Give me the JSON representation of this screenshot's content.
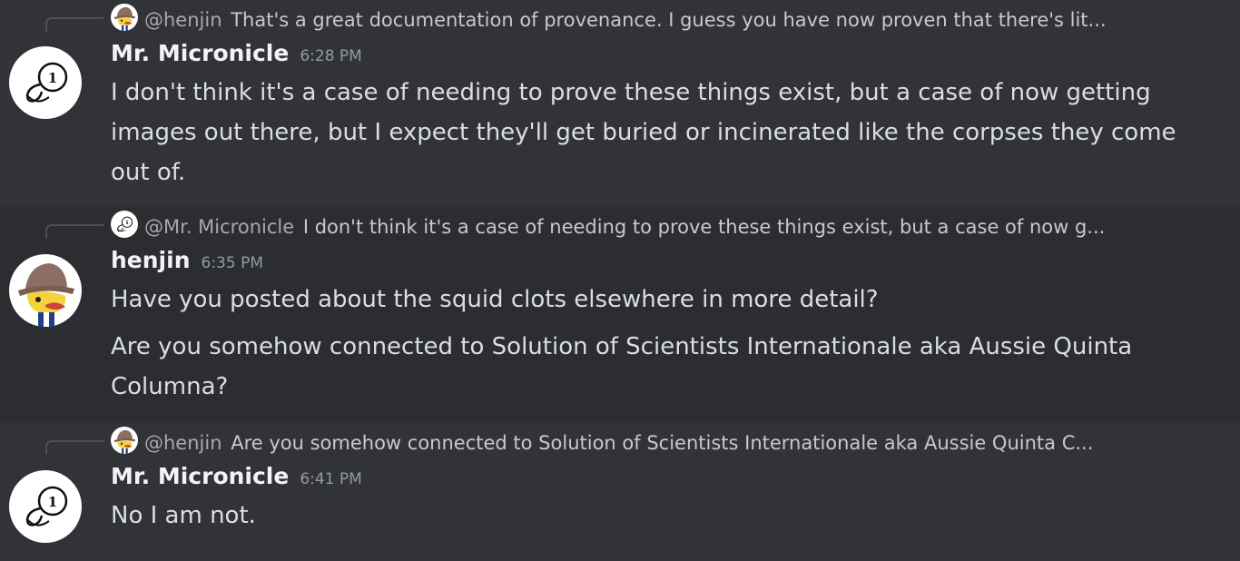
{
  "messages": [
    {
      "reply": {
        "author": "@henjin",
        "text": "That's a great documentation of provenance. I guess you have now proven that there's lit..."
      },
      "author": "Mr. Micronicle",
      "time": "6:28 PM",
      "lines": [
        "I don't think it's a case of needing to prove these things exist, but a case of now getting images out there, but I expect they'll get buried or incinerated  like the corpses they come out of."
      ]
    },
    {
      "reply": {
        "author": "@Mr. Micronicle",
        "text": "I don't think it's a case of needing to prove these things exist, but a case of now g..."
      },
      "author": "henjin",
      "time": "6:35 PM",
      "lines": [
        "Have you posted about the squid clots elsewhere in more detail?",
        "Are you somehow connected to Solution of Scientists Internationale aka Aussie Quinta Columna?"
      ]
    },
    {
      "reply": {
        "author": "@henjin",
        "text": "Are you somehow connected to Solution of Scientists Internationale aka Aussie Quinta C..."
      },
      "author": "Mr. Micronicle",
      "time": "6:41 PM",
      "lines": [
        "No I am not."
      ]
    }
  ],
  "theme": {
    "background": "#313338",
    "alt_background": "#2b2d31",
    "text": "#dbdee1",
    "muted": "#949ba4"
  }
}
